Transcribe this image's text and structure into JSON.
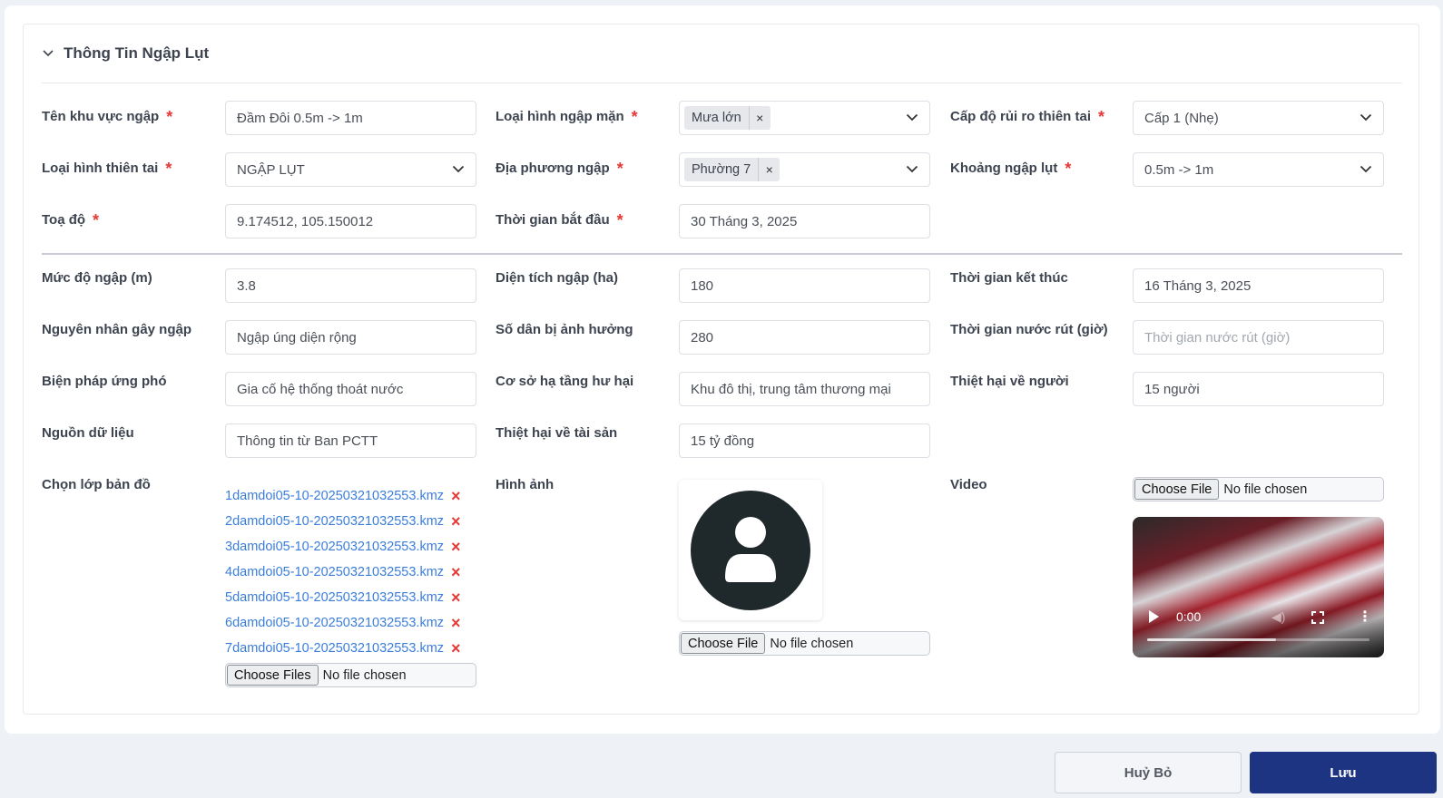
{
  "section": {
    "title": "Thông Tin Ngập Lụt"
  },
  "fields": {
    "ten_khu_vuc": {
      "label": "Tên khu vực ngập",
      "value": "Đầm Đôi 0.5m -> 1m"
    },
    "loai_hinh_ngap_man": {
      "label": "Loại hình ngập mặn",
      "tag": "Mưa lớn"
    },
    "cap_do_rui_ro": {
      "label": "Cấp độ rủi ro thiên tai",
      "value": "Cấp 1 (Nhẹ)"
    },
    "loai_hinh_thien_tai": {
      "label": "Loại hình thiên tai",
      "value": "NGẬP LỤT"
    },
    "dia_phuong_ngap": {
      "label": "Địa phương ngập",
      "tag": "Phường 7"
    },
    "khoang_ngap_lut": {
      "label": "Khoảng ngập lụt",
      "value": "0.5m -> 1m"
    },
    "toa_do": {
      "label": "Toạ độ",
      "value": "9.174512, 105.150012"
    },
    "thoi_gian_bat_dau": {
      "label": "Thời gian bắt đầu",
      "value": "30 Tháng 3, 2025"
    },
    "muc_do_ngap": {
      "label": "Mức độ ngập (m)",
      "value": "3.8"
    },
    "dien_tich_ngap": {
      "label": "Diện tích ngập (ha)",
      "value": "180"
    },
    "thoi_gian_ket_thuc": {
      "label": "Thời gian kết thúc",
      "value": "16 Tháng 3, 2025"
    },
    "nguyen_nhan": {
      "label": "Nguyên nhân gây ngập",
      "value": "Ngập úng diện rộng"
    },
    "so_dan": {
      "label": "Số dân bị ảnh hưởng",
      "value": "280"
    },
    "thoi_gian_nuoc_rut": {
      "label": "Thời gian nước rút (giờ)",
      "value": "",
      "placeholder": "Thời gian nước rút (giờ)"
    },
    "bien_phap": {
      "label": "Biện pháp ứng phó",
      "value": "Gia cố hệ thống thoát nước"
    },
    "co_so_ha_tang": {
      "label": "Cơ sở hạ tầng hư hại",
      "value": "Khu đô thị, trung tâm thương mại"
    },
    "thiet_hai_nguoi": {
      "label": "Thiệt hại về người",
      "value": "15 người"
    },
    "nguon_du_lieu": {
      "label": "Nguồn dữ liệu",
      "value": "Thông tin từ Ban PCTT"
    },
    "thiet_hai_tai_san": {
      "label": "Thiệt hại về tài sản",
      "value": "15 tỷ đồng"
    },
    "lop_ban_do": {
      "label": "Chọn lớp bản đồ"
    },
    "hinh_anh": {
      "label": "Hình ảnh"
    },
    "video": {
      "label": "Video"
    }
  },
  "required_mark": "*",
  "map_files": [
    "1damdoi05-10-20250321032553.kmz",
    "2damdoi05-10-20250321032553.kmz",
    "3damdoi05-10-20250321032553.kmz",
    "4damdoi05-10-20250321032553.kmz",
    "5damdoi05-10-20250321032553.kmz",
    "6damdoi05-10-20250321032553.kmz",
    "7damdoi05-10-20250321032553.kmz"
  ],
  "file_inputs": {
    "map": {
      "button": "Choose Files",
      "status": "No file chosen"
    },
    "image": {
      "button": "Choose File",
      "status": "No file chosen"
    },
    "video": {
      "button": "Choose File",
      "status": "No file chosen"
    }
  },
  "video_player": {
    "time": "0:00",
    "buffered_fraction": 0.58
  },
  "buttons": {
    "cancel": "Huỷ Bỏ",
    "save": "Lưu"
  },
  "colors": {
    "primary": "#1c3481",
    "required": "#e53935",
    "link": "#3b7ddd"
  }
}
